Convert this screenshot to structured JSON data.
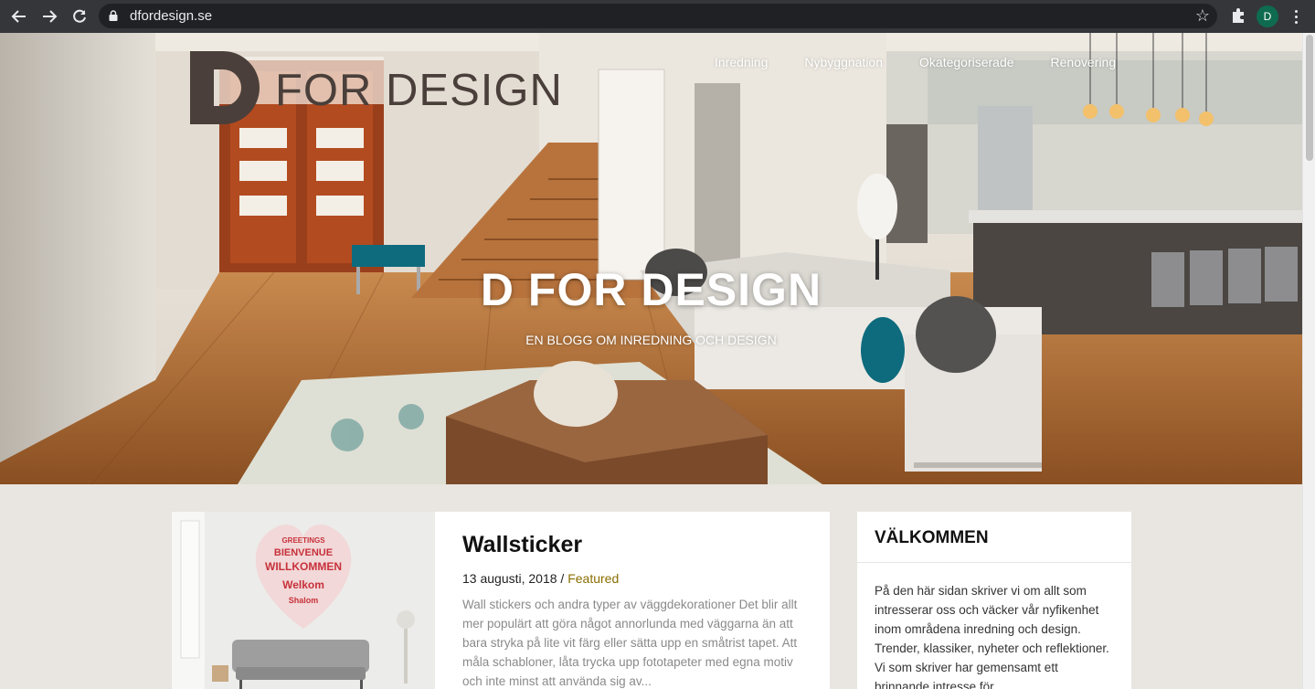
{
  "browser": {
    "url": "dfordesign.se",
    "profile_initial": "D",
    "icons": [
      "back-icon",
      "forward-icon",
      "reload-icon",
      "lock-icon",
      "star-icon",
      "puzzle-icon",
      "menu-icon"
    ]
  },
  "site": {
    "logo_text": "FOR DESIGN",
    "title": "D FOR DESIGN",
    "tagline": "EN BLOGG OM INREDNING OCH DESIGN",
    "nav": [
      "Inredning",
      "Nybyggnation",
      "Okategoriserade",
      "Renovering"
    ],
    "colors": {
      "logo": "#4a3f3a",
      "category_link": "#8a6d00",
      "background": "#e9e5e0"
    }
  },
  "post": {
    "title": "Wallsticker",
    "date": "13 augusti, 2018",
    "separator": " / ",
    "category": "Featured",
    "excerpt": "Wall stickers och andra typer av väggdekorationer Det blir allt mer populärt att göra något annorlunda med väggarna än att bara stryka på lite vit färg eller sätta upp en småtrist tapet. Att måla schabloner, låta trycka upp fototapeter med egna motiv och inte minst att använda sig av...",
    "thumb_words": [
      "GREETINGS",
      "BIENVENUE",
      "WILLKOMMEN",
      "Welkom",
      "Shalom"
    ]
  },
  "widget": {
    "title": "VÄLKOMMEN",
    "text": "På den här sidan skriver vi om allt som intresserar oss och väcker vår nyfikenhet inom områdena inredning och design. Trender, klassiker, nyheter och reflektioner. Vi som skriver har gemensamt ett brinnande intresse för"
  }
}
